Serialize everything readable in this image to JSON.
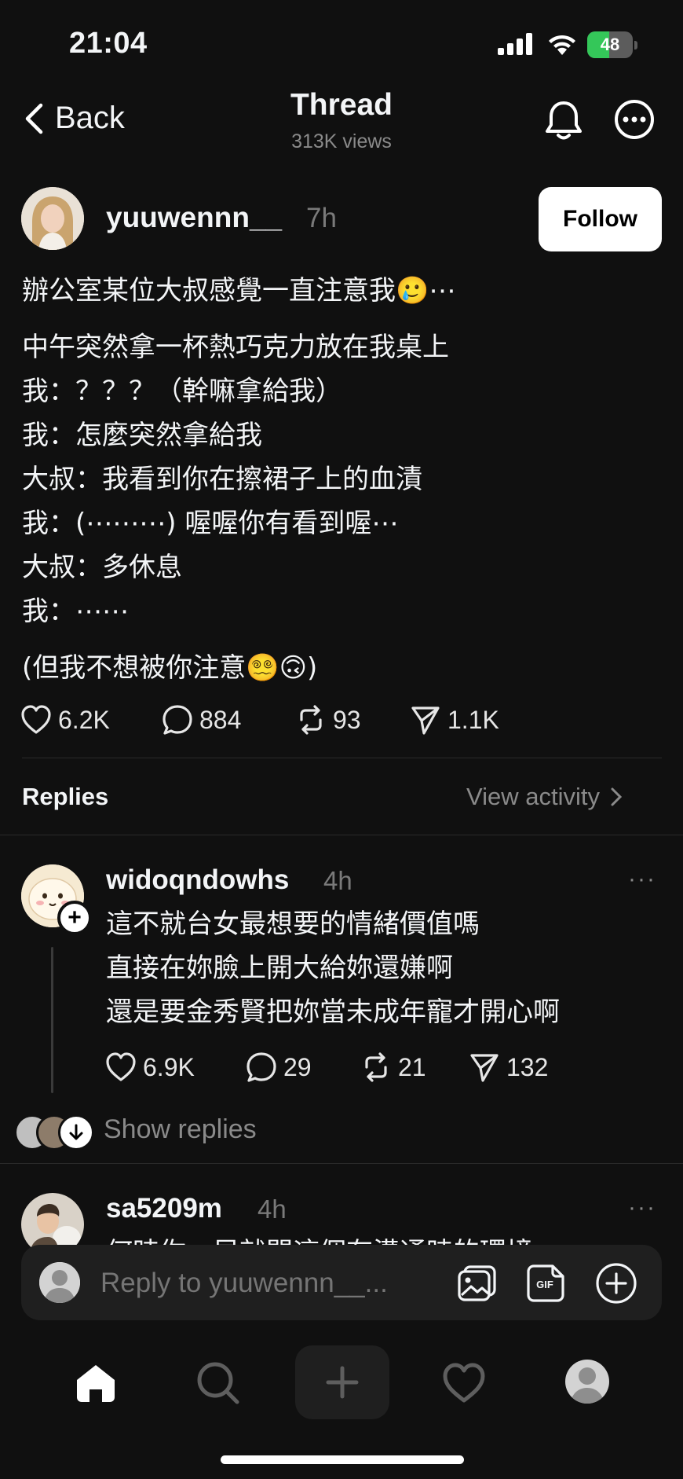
{
  "status_bar": {
    "time": "21:04",
    "battery": "48",
    "battery_level": 0.48
  },
  "nav": {
    "back_label": "Back",
    "title": "Thread",
    "views": "313K views"
  },
  "post": {
    "username": "yuuwennn__",
    "time": "7h",
    "follow_label": "Follow",
    "lines_first": [
      "辦公室某位大叔感覺一直注意我🥲⋯"
    ],
    "lines_middle": [
      "中午突然拿一杯熱巧克力放在我桌上",
      "我：？？？（幹嘛拿給我）",
      "我：怎麼突然拿給我",
      "大叔：我看到你在擦裙子上的血漬",
      "我：(⋯⋯⋯) 喔喔你有看到喔⋯",
      "大叔：多休息",
      "我：⋯⋯"
    ],
    "lines_last": [
      "(但我不想被你注意😵‍💫🙃)"
    ],
    "likes": "6.2K",
    "comments": "884",
    "reposts": "93",
    "shares": "1.1K"
  },
  "replies_header": {
    "label": "Replies",
    "view_activity": "View activity"
  },
  "replies": [
    {
      "username": "widoqndowhs",
      "time": "4h",
      "more": "···",
      "lines": [
        "這不就台女最想要的情緒價值嗎",
        "直接在妳臉上開大給妳還嫌啊",
        "還是要金秀賢把妳當未成年寵才開心啊"
      ],
      "likes": "6.9K",
      "comments": "29",
      "reposts": "21",
      "shares": "132",
      "show_replies": "Show replies"
    },
    {
      "username": "sa5209m",
      "time": "4h",
      "more": "···",
      "lines": [
        "何時你一早就開這個有溝通時的環境"
      ]
    }
  ],
  "composer": {
    "placeholder": "Reply to yuuwennn__..."
  },
  "colors": {
    "background": "#101010",
    "text": "#f3f5f7",
    "muted": "#8a8a8a",
    "battery_green": "#34c759"
  },
  "icons": [
    "back-chevron-icon",
    "bell-icon",
    "more-icon",
    "heart-icon",
    "comment-icon",
    "repost-icon",
    "share-icon",
    "image-icon",
    "gif-icon",
    "add-icon",
    "home-icon",
    "search-icon",
    "plus-icon",
    "activity-heart-icon",
    "profile-icon"
  ]
}
